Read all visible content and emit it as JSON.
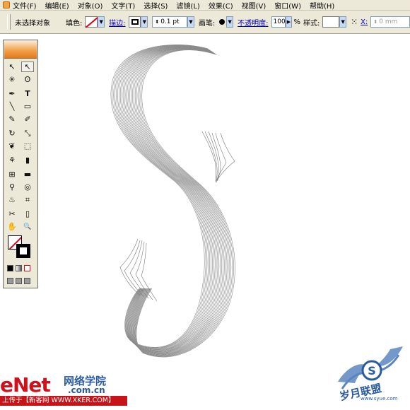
{
  "menubar": {
    "items": [
      "文件(F)",
      "编辑(E)",
      "对象(O)",
      "文字(T)",
      "选择(S)",
      "滤镜(L)",
      "效果(C)",
      "视图(V)",
      "窗口(W)",
      "帮助(H)"
    ]
  },
  "controlbar": {
    "status_label": "未选择对象",
    "fill_label": "填色:",
    "stroke_label": "描边:",
    "stroke_weight": "0.1 pt",
    "brush_label": "画笔:",
    "opacity_label": "不透明度:",
    "opacity_value": "100",
    "opacity_unit": "%",
    "style_label": "样式:",
    "x_label": "X:",
    "x_value": "0 mm"
  },
  "tools": {
    "row1": [
      "selection-arrow",
      "direct-selection-arrow"
    ],
    "selection_glyph": "↖",
    "direct_glyph": "↖",
    "type_glyph": "T",
    "magic_glyph": "✳",
    "lasso_glyph": "ʘ",
    "pen_glyph": "✒",
    "line_glyph": "╲",
    "rect_glyph": "▭",
    "brush_glyph": "✎",
    "pencil_glyph": "✐",
    "rotate_glyph": "↻",
    "scale_glyph": "⤡",
    "warp_glyph": "❦",
    "free_glyph": "⬚",
    "symbol_glyph": "⚘",
    "graph_glyph": "▮",
    "mesh_glyph": "⊞",
    "gradient_glyph": "▬",
    "eyedropper_glyph": "⚲",
    "blend_glyph": "◎",
    "bucket_glyph": "♨",
    "slice_glyph": "⌗",
    "scissors_glyph": "✂",
    "eraser_glyph": "▯",
    "hand_glyph": "✋",
    "zoom_glyph": "🔍"
  },
  "watermark": {
    "enet": "eNet",
    "site_cn": "网络学院",
    "site_url": ".com.cn",
    "upload_credit": "上传于【新客网 WWW.XKER.COM】",
    "logo_text": "岁月联盟",
    "logo_url": "www.syue.com"
  },
  "colors": {
    "accent_blue": "#2a5aa0",
    "watermark_red": "#d0101a",
    "line_gray": "#888888"
  }
}
